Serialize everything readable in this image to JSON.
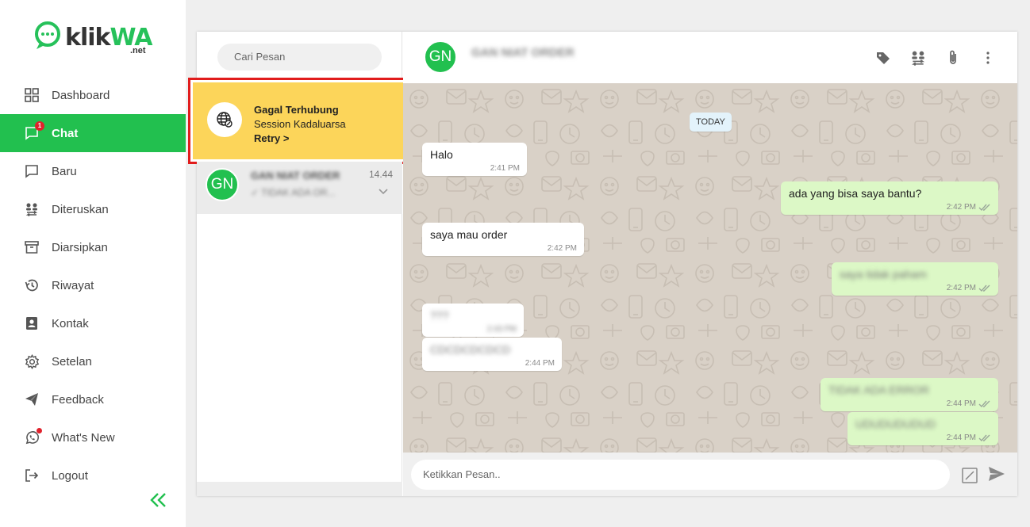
{
  "brand": {
    "name_part1": "klik",
    "name_part2": "WA",
    "suffix": ".net"
  },
  "colors": {
    "accent": "#22c04f",
    "alert_bg": "#fcd55a",
    "alert_border": "#e11c1c",
    "bubble_out": "#dcf8c6",
    "badge": "#e0222c"
  },
  "sidebar": {
    "items": [
      {
        "label": "Dashboard",
        "icon": "dashboard-grid-icon"
      },
      {
        "label": "Chat",
        "icon": "chat-icon",
        "badge": "1",
        "active": true
      },
      {
        "label": "Baru",
        "icon": "chat-outline-icon"
      },
      {
        "label": "Diteruskan",
        "icon": "forward-users-icon"
      },
      {
        "label": "Diarsipkan",
        "icon": "archive-icon"
      },
      {
        "label": "Riwayat",
        "icon": "history-icon"
      },
      {
        "label": "Kontak",
        "icon": "contact-icon"
      },
      {
        "label": "Setelan",
        "icon": "gear-icon"
      },
      {
        "label": "Feedback",
        "icon": "send-icon"
      },
      {
        "label": "What's New",
        "icon": "whatsapp-icon"
      },
      {
        "label": "Logout",
        "icon": "logout-icon"
      }
    ],
    "collapse_icon": "double-chevron-left-icon"
  },
  "conversations": {
    "search_placeholder": "Cari Pesan",
    "alert": {
      "title": "Gagal Terhubung",
      "subtitle": "Session Kadaluarsa",
      "action": "Retry >"
    },
    "items": [
      {
        "avatar": "GN",
        "name": "GAN NIAT ORDER",
        "preview": "✓ TIDAK ADA OR...",
        "time": "14.44"
      }
    ]
  },
  "chat": {
    "header": {
      "avatar": "GN",
      "name": "GAN NIAT ORDER"
    },
    "date_separator": "TODAY",
    "messages": [
      {
        "dir": "in",
        "text": "Halo",
        "time": "2:41 PM"
      },
      {
        "dir": "out",
        "text": "ada yang bisa saya bantu?",
        "time": "2:42 PM"
      },
      {
        "dir": "in",
        "text": "saya mau order",
        "time": "2:42 PM"
      },
      {
        "dir": "out",
        "text": "saya tidak paham",
        "time": "2:42 PM"
      },
      {
        "dir": "in",
        "text": "???",
        "time": "2:43 PM"
      },
      {
        "dir": "in",
        "text": "CDCDCDCDCD",
        "time": "2:44 PM"
      },
      {
        "dir": "out",
        "text": "TIDAK ADA ERROR",
        "time": "2:44 PM"
      },
      {
        "dir": "out",
        "text": "UDUDUDUDUD",
        "time": "2:44 PM"
      }
    ],
    "input_placeholder": "Ketikkan Pesan.."
  }
}
